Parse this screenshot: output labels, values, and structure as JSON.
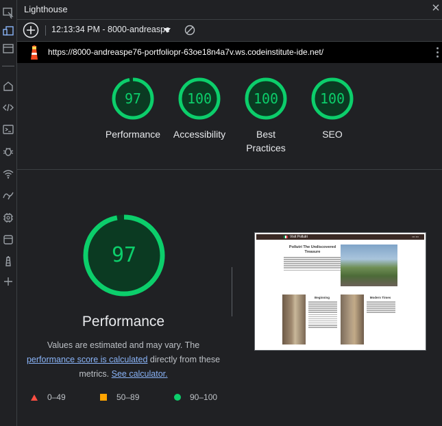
{
  "window": {
    "title": "Lighthouse"
  },
  "toolbar": {
    "report_selector": "12:13:34 PM - 8000-andreaspe",
    "add_icon": "plus-circle-icon",
    "clear_icon": "block-icon"
  },
  "url_bar": {
    "url": "https://8000-andreaspe76-portfoliopr-63oe18n4a7v.ws.codeinstitute-ide.net/"
  },
  "sidebar": {
    "icons": [
      "inspect-icon",
      "device-toggle-icon",
      "window-icon",
      "home-icon",
      "code-icon",
      "console-icon",
      "bug-icon",
      "wifi-icon",
      "performance-icon",
      "cpu-icon",
      "application-icon",
      "lighthouse-icon",
      "add-icon"
    ]
  },
  "scores": [
    {
      "label": "Performance",
      "value": "97",
      "score": 0.97
    },
    {
      "label": "Accessibility",
      "value": "100",
      "score": 1.0
    },
    {
      "label": "Best Practices",
      "value": "100",
      "score": 1.0
    },
    {
      "label": "SEO",
      "value": "100",
      "score": 1.0
    }
  ],
  "score_labels": {
    "best_practices_line1": "Best",
    "best_practices_line2": "Practices"
  },
  "performance": {
    "value": "97",
    "score": 0.97,
    "title": "Performance",
    "desc_part1": "Values are estimated and may vary. The",
    "desc_link1": "performance score is calculated",
    "desc_part2": "directly from these metrics.",
    "desc_link2": "See calculator."
  },
  "legend": [
    {
      "range": "0–49",
      "color": "#ff4e42"
    },
    {
      "range": "50–89",
      "color": "#ffa400"
    },
    {
      "range": "90–100",
      "color": "#0cce6b"
    }
  ],
  "thumbnail": {
    "brand": "Visit Pollutri",
    "heading": "Pollutri The Undiscovered Treasure",
    "card1_title": "Beginning",
    "card2_title": "Modern Times"
  },
  "colors": {
    "pass": "#0cce6b",
    "pass_bg": "#0b3a22",
    "link": "#8ab4f8"
  }
}
